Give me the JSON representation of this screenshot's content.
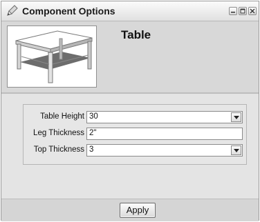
{
  "window": {
    "title": "Component Options",
    "controls": [
      "minimize-icon",
      "maximize-icon",
      "close-icon"
    ]
  },
  "component": {
    "name": "Table",
    "preview_icon": "table-3d-preview"
  },
  "options": [
    {
      "label": "Table Height",
      "value": "30",
      "type": "dropdown"
    },
    {
      "label": "Leg Thickness",
      "value": "2\"",
      "type": "text"
    },
    {
      "label": "Top Thickness",
      "value": "3",
      "type": "dropdown"
    }
  ],
  "footer": {
    "apply_label": "Apply"
  }
}
